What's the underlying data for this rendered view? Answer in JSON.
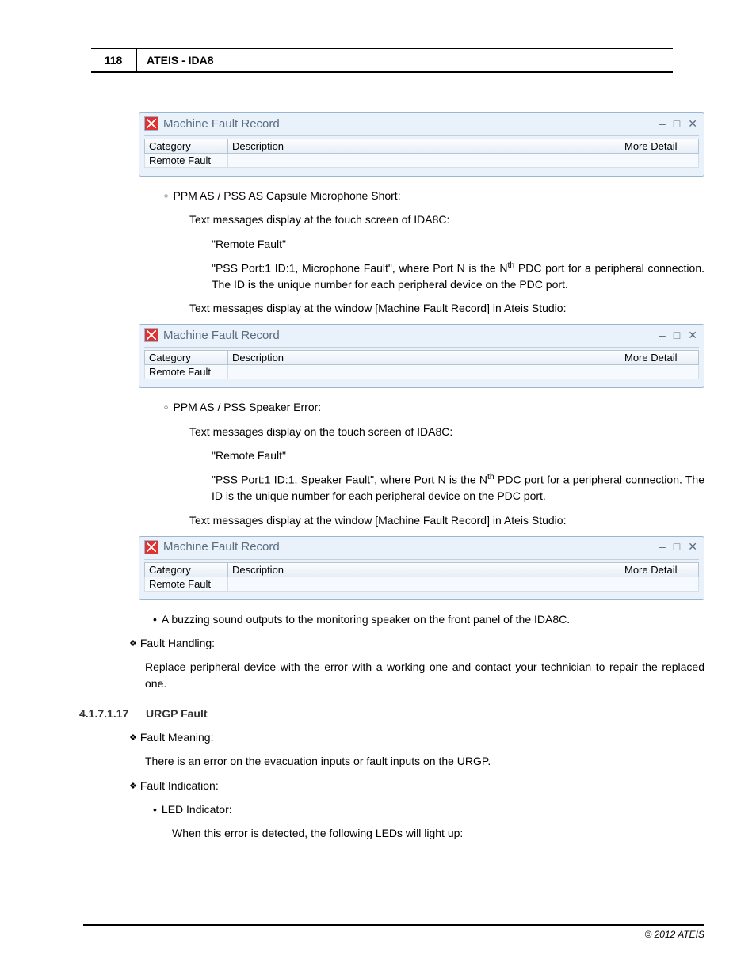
{
  "page_number": "118",
  "header_title": "ATEIS - IDA8",
  "mfr": {
    "title": "Machine Fault Record",
    "headers": {
      "category": "Category",
      "description": "Description",
      "more_detail": "More Detail"
    },
    "row_category": "Remote Fault"
  },
  "body": {
    "topic1_heading": "PPM AS / PSS AS Capsule Microphone Short:",
    "topic1_p1": "Text messages display at the touch screen of IDA8C:",
    "topic1_q1": "\"Remote Fault\"",
    "topic1_q2a": "\"PSS Port:1 ID:1, Microphone Fault\", where Port N is the N",
    "topic1_q2_sup": "th",
    "topic1_q2b": " PDC port for a peripheral connection. The ID is the unique number for each peripheral device on the PDC port.",
    "topic1_p2": "Text messages display at the window [Machine Fault Record] in Ateis Studio:",
    "topic2_heading": "PPM AS / PSS Speaker Error:",
    "topic2_p1": "Text messages display on the touch screen of IDA8C:",
    "topic2_q1": "\"Remote Fault\"",
    "topic2_q2a": "\"PSS Port:1 ID:1, Speaker Fault\", where Port N is the N",
    "topic2_q2_sup": "th",
    "topic2_q2b": " PDC port for a peripheral connection. The ID is the unique number for each peripheral device on the PDC port.",
    "topic2_p2": "Text messages display at the window [Machine Fault Record] in Ateis Studio:",
    "buzz_line": "A buzzing sound outputs to the monitoring speaker on the front panel of the IDA8C.",
    "fault_handling_label": "Fault Handling:",
    "fault_handling_text": "Replace peripheral device with the error with a working one and contact your technician to repair the replaced one.",
    "section_num": "4.1.7.1.17",
    "section_title": "URGP Fault",
    "fault_meaning_label": "Fault Meaning:",
    "fault_meaning_text": "There is an error on the evacuation inputs or fault inputs on the URGP.",
    "fault_indication_label": "Fault Indication:",
    "led_label": "LED Indicator:",
    "led_text": "When this error is detected, the following LEDs will light up:"
  },
  "footer": "© 2012 ATEÏS"
}
